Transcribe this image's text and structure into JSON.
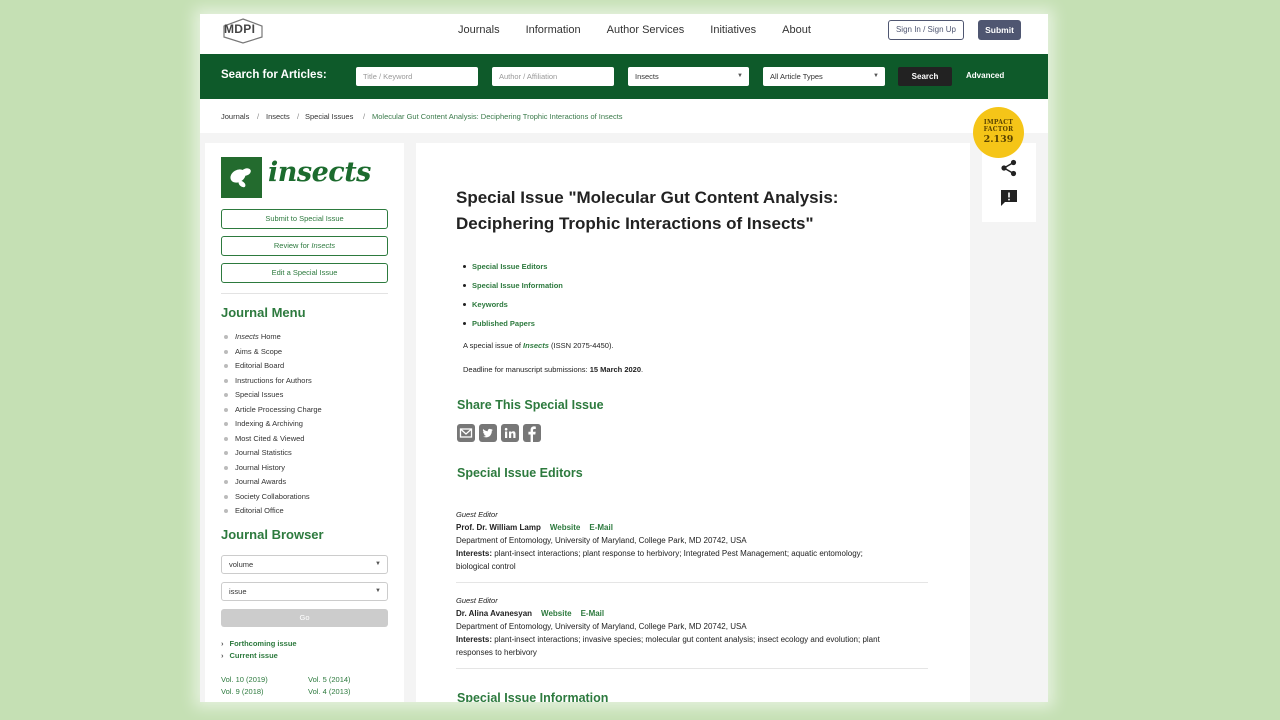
{
  "topnav": {
    "logo": "MDPI",
    "links": [
      "Journals",
      "Information",
      "Author Services",
      "Initiatives",
      "About"
    ],
    "sign_in": "Sign In / Sign Up",
    "submit": "Submit"
  },
  "searchbar": {
    "label": "Search for Articles:",
    "title_placeholder": "Title / Keyword",
    "author_placeholder": "Author / Affiliation",
    "journal_value": "Insects",
    "type_value": "All Article Types",
    "search_button": "Search",
    "advanced": "Advanced"
  },
  "breadcrumb": {
    "items": [
      "Journals",
      "Insects",
      "Special Issues"
    ],
    "separator": "/",
    "current": "Molecular Gut Content Analysis: Deciphering Trophic Interactions of Insects"
  },
  "impact": {
    "line1": "IMPACT",
    "line2": "FACTOR",
    "value": "2.139"
  },
  "icons": {
    "share": "share-icon",
    "feedback": "feedback-icon"
  },
  "sidebar": {
    "journal_name": "insects",
    "buttons": {
      "submit_prefix": "Submit to Special Issue",
      "review_prefix": "Review for ",
      "review_journal": "Insects",
      "edit": "Edit a Special Issue"
    },
    "journal_menu_title": "Journal Menu",
    "menu_home_journal": "Insects",
    "menu_home_suffix": " Home",
    "menu": [
      "Aims & Scope",
      "Editorial Board",
      "Instructions for Authors",
      "Special Issues",
      "Article Processing Charge",
      "Indexing & Archiving",
      "Most Cited & Viewed",
      "Journal Statistics",
      "Journal History",
      "Journal Awards",
      "Society Collaborations",
      "Editorial Office"
    ],
    "journal_browser_title": "Journal Browser",
    "volume_select": "volume",
    "issue_select": "issue",
    "go": "Go",
    "forthcoming": "Forthcoming issue",
    "current": "Current issue",
    "volumes_left": [
      "Vol. 10 (2019)",
      "Vol. 9 (2018)"
    ],
    "volumes_right": [
      "Vol. 5 (2014)",
      "Vol. 4 (2013)"
    ]
  },
  "main": {
    "title_line1": "Special Issue \"Molecular Gut Content Analysis:",
    "title_line2": "Deciphering Trophic Interactions of Insects\"",
    "toc": [
      "Special Issue Editors",
      "Special Issue Information",
      "Keywords",
      "Published Papers"
    ],
    "issn_prefix": "A special issue of ",
    "issn_journal": "Insects",
    "issn_suffix": " (ISSN 2075-4450).",
    "deadline_prefix": "Deadline for manuscript submissions: ",
    "deadline_date": "15 March 2020",
    "deadline_suffix": ".",
    "share_heading": "Share This Special Issue",
    "share_icons": [
      "email-icon",
      "twitter-icon",
      "linkedin-icon",
      "facebook-icon"
    ],
    "editors_heading": "Special Issue Editors",
    "editors": [
      {
        "role": "Guest Editor",
        "name": "Prof. Dr. William Lamp",
        "website": "Website",
        "email": "E-Mail",
        "affiliation": "Department of Entomology, University of Maryland, College Park, MD 20742, USA",
        "interests_label": "Interests:",
        "interests_line1": " plant-insect interactions; plant response to herbivory; Integrated Pest Management; aquatic entomology;",
        "interests_line2": "biological control"
      },
      {
        "role": "Guest Editor",
        "name": "Dr. Alina Avanesyan",
        "website": "Website",
        "email": "E-Mail",
        "affiliation": "Department of Entomology, University of Maryland, College Park, MD 20742, USA",
        "interests_label": "Interests:",
        "interests_line1": " plant-insect interactions; invasive species; molecular gut content analysis; insect ecology and evolution; plant",
        "interests_line2": "responses to herbivory"
      }
    ],
    "info_heading": "Special Issue Information"
  }
}
